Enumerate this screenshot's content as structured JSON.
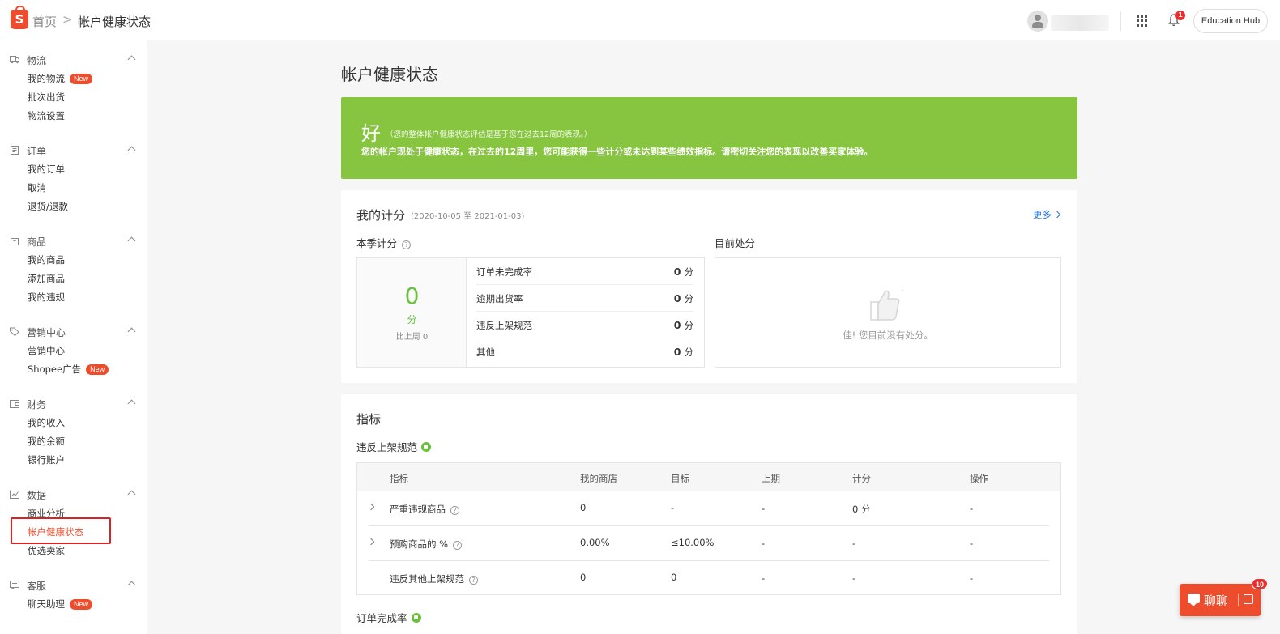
{
  "header": {
    "logo_icon": "shopee-bag-icon",
    "breadcrumb_home": "首页",
    "breadcrumb_separator": ">",
    "breadcrumb_current": "帐户健康状态",
    "notification_count": "1",
    "education_hub": "Education Hub"
  },
  "sidebar": {
    "sections": [
      {
        "title": "物流",
        "icon": "truck-icon",
        "items": [
          {
            "label": "我的物流",
            "badge": "New"
          },
          {
            "label": "批次出货"
          },
          {
            "label": "物流设置"
          }
        ]
      },
      {
        "title": "订单",
        "icon": "clipboard-icon",
        "items": [
          {
            "label": "我的订单"
          },
          {
            "label": "取消"
          },
          {
            "label": "退货/退款"
          }
        ]
      },
      {
        "title": "商品",
        "icon": "bag-icon",
        "items": [
          {
            "label": "我的商品"
          },
          {
            "label": "添加商品"
          },
          {
            "label": "我的违规"
          }
        ]
      },
      {
        "title": "营销中心",
        "icon": "tag-icon",
        "items": [
          {
            "label": "营销中心"
          },
          {
            "label": "Shopee广告",
            "badge": "New"
          }
        ]
      },
      {
        "title": "财务",
        "icon": "wallet-icon",
        "items": [
          {
            "label": "我的收入"
          },
          {
            "label": "我的余额"
          },
          {
            "label": "银行账户"
          }
        ]
      },
      {
        "title": "数据",
        "icon": "chart-line-icon",
        "items": [
          {
            "label": "商业分析"
          },
          {
            "label": "帐户健康状态",
            "active": true
          },
          {
            "label": "优选卖家"
          }
        ]
      },
      {
        "title": "客服",
        "icon": "chat-bubble-icon",
        "items": [
          {
            "label": "聊天助理",
            "badge": "New"
          }
        ]
      }
    ]
  },
  "main": {
    "page_title": "帐户健康状态",
    "banner": {
      "grade": "好",
      "note": "（您的整体帐户健康状态评估是基于您在过去12周的表现。）",
      "description": "您的帐户现处于健康状态，在过去的12周里，您可能获得一些计分或未达到某些绩效指标。请密切关注您的表现以改善买家体验。",
      "color": "#87c440"
    },
    "points": {
      "title": "我的计分",
      "range": "(2020-10-05 至 2021-01-03)",
      "more": "更多",
      "quarter_title": "本季计分",
      "help_icon": "?",
      "total": "0",
      "unit": "分",
      "compare": "比上周 0",
      "rows": [
        {
          "label": "订单未完成率",
          "value": "0",
          "unit": "分"
        },
        {
          "label": "逾期出货率",
          "value": "0",
          "unit": "分"
        },
        {
          "label": "违反上架规范",
          "value": "0",
          "unit": "分"
        },
        {
          "label": "其他",
          "value": "0",
          "unit": "分"
        }
      ],
      "penalty_title": "目前处分",
      "penalty_empty": "佳! 您目前没有处分。"
    },
    "metrics": {
      "title": "指标",
      "section_title": "违反上架规范",
      "columns": [
        "指标",
        "我的商店",
        "目标",
        "上期",
        "计分",
        "操作"
      ],
      "rows": [
        {
          "metric": "严重违规商品",
          "mine": "0",
          "target": "-",
          "previous": "-",
          "points": "0 分",
          "action": "-",
          "expandable": true
        },
        {
          "metric": "预购商品的 %",
          "mine": "0.00%",
          "target": "≤10.00%",
          "previous": "-",
          "points": "-",
          "action": "-",
          "expandable": true
        },
        {
          "metric": "违反其他上架规范",
          "mine": "0",
          "target": "0",
          "previous": "-",
          "points": "-",
          "action": "-",
          "expandable": false
        }
      ],
      "next_section_title": "订单完成率"
    }
  },
  "chat": {
    "label": "聊聊",
    "badge": "10",
    "color": "#ee4d2d"
  }
}
